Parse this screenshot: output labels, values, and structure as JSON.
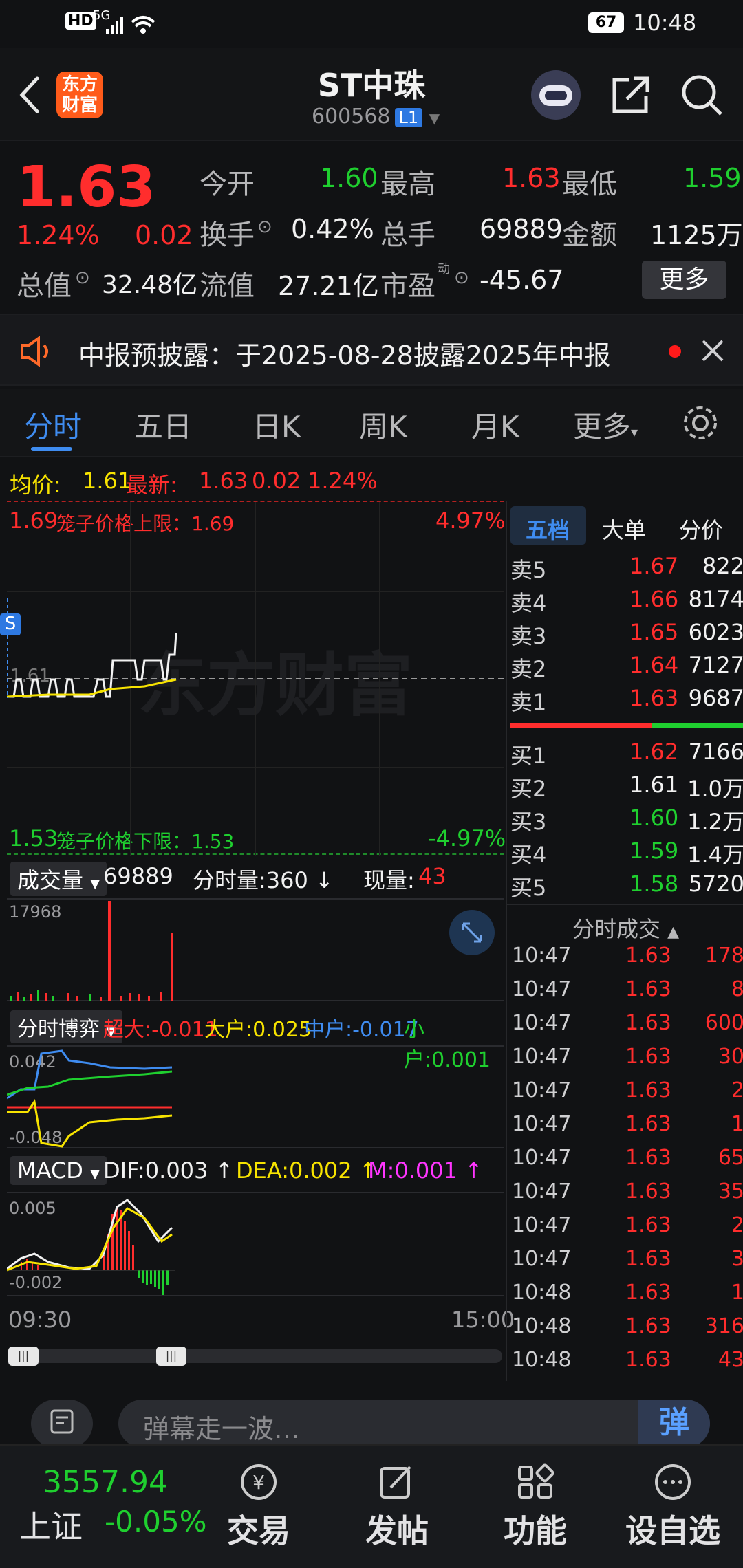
{
  "status": {
    "hd": "HD",
    "signal": "5G",
    "battery": "67",
    "time": "10:48"
  },
  "header": {
    "logo_line1": "东方",
    "logo_line2": "财富",
    "title": "ST中珠",
    "code": "600568",
    "level": "L1"
  },
  "quote": {
    "price": "1.63",
    "pct": "1.24%",
    "chg": "0.02",
    "open_label": "今开",
    "open": "1.60",
    "high_label": "最高",
    "high": "1.63",
    "low_label": "最低",
    "low": "1.59",
    "turnover_label": "换手",
    "turnover": "0.42%",
    "volume_label": "总手",
    "volume": "69889",
    "amount_label": "金额",
    "amount": "1125万",
    "mcap_label": "总值",
    "mcap": "32.48亿",
    "float_label": "流值",
    "float": "27.21亿",
    "pe_label": "市盈",
    "pe_sup": "动",
    "pe": "-45.67",
    "more": "更多"
  },
  "notice": {
    "text": "中报预披露：于2025-08-28披露2025年中报"
  },
  "tabs": [
    "分时",
    "五日",
    "日K",
    "周K",
    "月K",
    "更多"
  ],
  "avg_bar": {
    "avg_label": "均价:",
    "avg": "1.61",
    "latest_label": "最新:",
    "latest": "1.63",
    "chg": "0.02",
    "pct": "1.24%"
  },
  "chart": {
    "upper_price": "1.69",
    "upper_text": "笼子价格上限：1.69",
    "upper_pct": "4.97%",
    "lower_price": "1.53",
    "lower_text": "笼子价格下限：1.53",
    "lower_pct": "-4.97%",
    "ref_price": "1.61",
    "marker": "S",
    "watermark": "东方财富",
    "vol_label": "成交量",
    "vol_total": "69889",
    "vol_min_label": "分时量:360",
    "vol_now_label": "现量:",
    "vol_now": "43",
    "vol_max": "17968",
    "bo_label": "分时博弈",
    "bo_cd": "超大:-0.011",
    "bo_dh": "大户:0.025",
    "bo_zh": "中户:-0.017",
    "bo_xh": "小户:0.001",
    "bo_max": "0.042",
    "bo_min": "-0.048",
    "macd_label": "MACD",
    "dif": "DIF:0.003",
    "dea": "DEA:0.002",
    "m": "M:0.001",
    "macd_max": "0.005",
    "macd_min": "-0.002",
    "time_start": "09:30",
    "time_end": "15:00"
  },
  "orderbook": {
    "tabs": [
      "五档",
      "大单",
      "分价"
    ],
    "asks": [
      {
        "label": "卖5",
        "price": "1.67",
        "vol": "822"
      },
      {
        "label": "卖4",
        "price": "1.66",
        "vol": "8174"
      },
      {
        "label": "卖3",
        "price": "1.65",
        "vol": "6023"
      },
      {
        "label": "卖2",
        "price": "1.64",
        "vol": "7127"
      },
      {
        "label": "卖1",
        "price": "1.63",
        "vol": "9687"
      }
    ],
    "bids": [
      {
        "label": "买1",
        "price": "1.62",
        "vol": "7166"
      },
      {
        "label": "买2",
        "price": "1.61",
        "vol": "1.0万"
      },
      {
        "label": "买3",
        "price": "1.60",
        "vol": "1.2万"
      },
      {
        "label": "买4",
        "price": "1.59",
        "vol": "1.4万"
      },
      {
        "label": "买5",
        "price": "1.58",
        "vol": "5720"
      }
    ],
    "trades_title": "分时成交",
    "trades": [
      {
        "t": "10:47",
        "p": "1.63",
        "v": "178"
      },
      {
        "t": "10:47",
        "p": "1.63",
        "v": "8"
      },
      {
        "t": "10:47",
        "p": "1.63",
        "v": "600"
      },
      {
        "t": "10:47",
        "p": "1.63",
        "v": "30"
      },
      {
        "t": "10:47",
        "p": "1.63",
        "v": "2"
      },
      {
        "t": "10:47",
        "p": "1.63",
        "v": "1"
      },
      {
        "t": "10:47",
        "p": "1.63",
        "v": "65"
      },
      {
        "t": "10:47",
        "p": "1.63",
        "v": "35"
      },
      {
        "t": "10:47",
        "p": "1.63",
        "v": "2"
      },
      {
        "t": "10:47",
        "p": "1.63",
        "v": "3"
      },
      {
        "t": "10:48",
        "p": "1.63",
        "v": "1"
      },
      {
        "t": "10:48",
        "p": "1.63",
        "v": "316"
      },
      {
        "t": "10:48",
        "p": "1.63",
        "v": "43"
      }
    ]
  },
  "danmu": {
    "placeholder": "弹幕走一波…",
    "btn": "弹"
  },
  "bottom": {
    "index_value": "3557.94",
    "index_name": "上证",
    "index_pct": "-0.05%",
    "nav": [
      "交易",
      "发帖",
      "功能",
      "设自选"
    ]
  },
  "colors": {
    "up": "#ff2d2d",
    "down": "#1fcf2f",
    "accent": "#3f8cf0",
    "avg": "#f7e300"
  }
}
